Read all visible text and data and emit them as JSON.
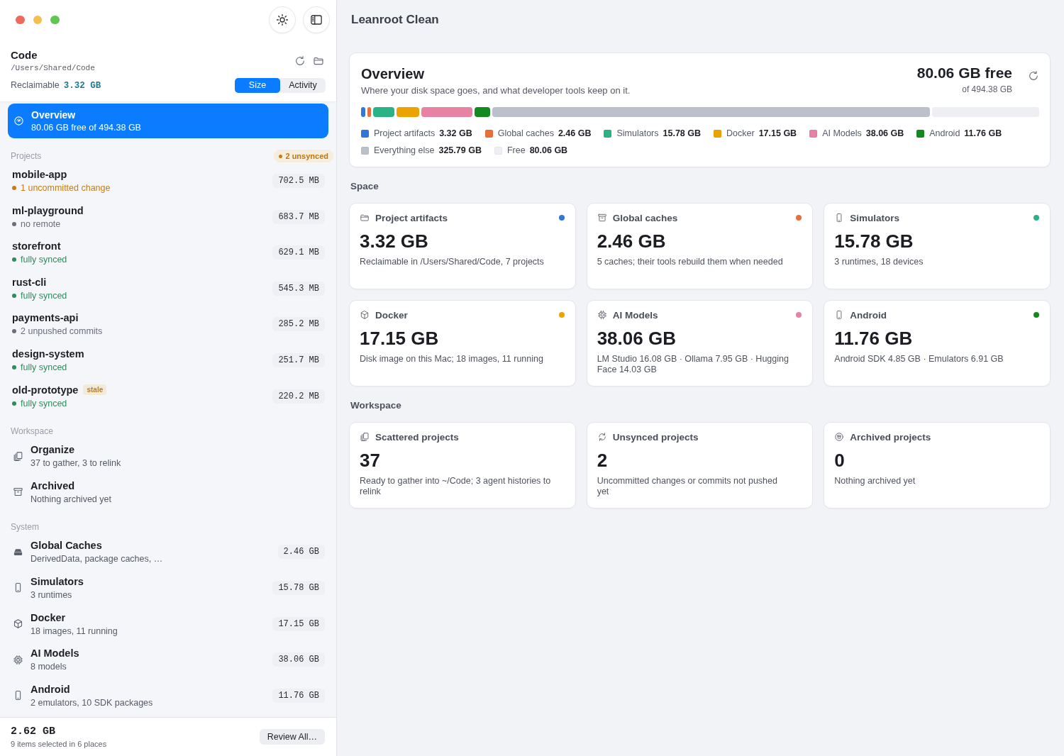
{
  "sidebar": {
    "folder": {
      "name": "Code",
      "path": "/Users/Shared/Code"
    },
    "reclaimable": {
      "label": "Reclaimable",
      "value": "3.32 GB"
    },
    "sort_tabs": [
      {
        "label": "Size",
        "selected": true
      },
      {
        "label": "Activity",
        "selected": false
      }
    ],
    "overview_item": {
      "title": "Overview",
      "subtitle": "80.06 GB free of 494.38 GB",
      "selected": true
    },
    "projects": {
      "heading": "Projects",
      "badge": "2 unsynced",
      "items": [
        {
          "name": "mobile-app",
          "status": "1 uncommitted change",
          "color": "#c47d17",
          "size": "702.5 MB",
          "selected": false
        },
        {
          "name": "ml-playground",
          "status": "no remote",
          "color": "#6b6e7c",
          "size": "683.7 MB",
          "selected": false
        },
        {
          "name": "storefront",
          "status": "fully synced",
          "color": "#2e8b5c",
          "size": "629.1 MB",
          "selected": false
        },
        {
          "name": "rust-cli",
          "status": "fully synced",
          "color": "#2e8b5c",
          "size": "545.3 MB",
          "selected": false
        },
        {
          "name": "payments-api",
          "status": "2 unpushed commits",
          "color": "#6b6e7c",
          "size": "285.2 MB",
          "selected": false
        },
        {
          "name": "design-system",
          "status": "fully synced",
          "color": "#2e8b5c",
          "size": "251.7 MB",
          "selected": false
        },
        {
          "name": "old-prototype",
          "tag": "stale",
          "status": "fully synced",
          "color": "#2e8b5c",
          "size": "220.2 MB",
          "selected": false
        }
      ]
    },
    "workspace": {
      "heading": "Workspace",
      "items": [
        {
          "title": "Organize",
          "subtitle": "37 to gather, 3 to relink",
          "selected": false
        },
        {
          "title": "Archived",
          "subtitle": "Nothing archived yet",
          "selected": false
        }
      ]
    },
    "system": {
      "heading": "System",
      "items": [
        {
          "title": "Global Caches",
          "subtitle": "DerivedData, package caches, …",
          "size": "2.46 GB",
          "selected": false
        },
        {
          "title": "Simulators",
          "subtitle": "3 runtimes",
          "size": "15.78 GB",
          "selected": false
        },
        {
          "title": "Docker",
          "subtitle": "18 images, 11 running",
          "size": "17.15 GB",
          "selected": false
        },
        {
          "title": "AI Models",
          "subtitle": "8 models",
          "size": "38.06 GB",
          "selected": false
        },
        {
          "title": "Android",
          "subtitle": "2 emulators, 10 SDK packages",
          "size": "11.76 GB",
          "selected": false
        }
      ]
    },
    "footer": {
      "total": "2.62 GB",
      "caption": "9 items selected in 6 places",
      "button": "Review All…"
    }
  },
  "main": {
    "title": "Leanroot Clean",
    "overview": {
      "title": "Overview",
      "subtitle": "Where your disk space goes, and what developer tools keep on it.",
      "free": "80.06 GB free",
      "total": "of 494.38 GB",
      "breakdown": [
        {
          "label": "Project artifacts",
          "value": "3.32 GB",
          "color": "#2f78d8"
        },
        {
          "label": "Global caches",
          "value": "2.46 GB",
          "color": "#e86e3a"
        },
        {
          "label": "Simulators",
          "value": "15.78 GB",
          "color": "#2bb287"
        },
        {
          "label": "Docker",
          "value": "17.15 GB",
          "color": "#eaa300"
        },
        {
          "label": "AI Models",
          "value": "38.06 GB",
          "color": "#e882a3"
        },
        {
          "label": "Android",
          "value": "11.76 GB",
          "color": "#13891f"
        },
        {
          "label": "Everything else",
          "value": "325.79 GB",
          "color": "#bcc0cb"
        },
        {
          "label": "Free",
          "value": "80.06 GB",
          "color": "#eeeff2"
        }
      ]
    },
    "space": {
      "heading": "Space",
      "cards": [
        {
          "title": "Project artifacts",
          "value": "3.32 GB",
          "detail": "Reclaimable in /Users/Shared/Code, 7 projects",
          "color": "#2f78d8"
        },
        {
          "title": "Global caches",
          "value": "2.46 GB",
          "detail": "5 caches; their tools rebuild them when needed",
          "color": "#e86e3a"
        },
        {
          "title": "Simulators",
          "value": "15.78 GB",
          "detail": "3 runtimes, 18 devices",
          "color": "#2bb287"
        },
        {
          "title": "Docker",
          "value": "17.15 GB",
          "detail": "Disk image on this Mac; 18 images, 11 running",
          "color": "#eaa300"
        },
        {
          "title": "AI Models",
          "value": "38.06 GB",
          "detail": "LM Studio 16.08 GB · Ollama 7.95 GB · Hugging Face 14.03 GB",
          "color": "#e882a3"
        },
        {
          "title": "Android",
          "value": "11.76 GB",
          "detail": "Android SDK 4.85 GB · Emulators 6.91 GB",
          "color": "#13891f"
        }
      ]
    },
    "workspace": {
      "heading": "Workspace",
      "cards": [
        {
          "title": "Scattered projects",
          "value": "37",
          "detail": "Ready to gather into ~/Code; 3 agent histories to relink"
        },
        {
          "title": "Unsynced projects",
          "value": "2",
          "detail": "Uncommitted changes or commits not pushed yet"
        },
        {
          "title": "Archived projects",
          "value": "0",
          "detail": "Nothing archived yet"
        }
      ]
    }
  }
}
